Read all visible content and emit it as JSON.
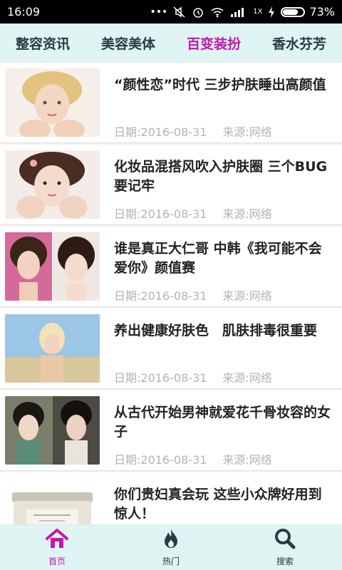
{
  "status": {
    "time": "16:09",
    "network_label": "1X",
    "battery_text": "73%",
    "battery_level": 0.73
  },
  "tabs": [
    {
      "label": "整容资讯",
      "active": false
    },
    {
      "label": "美容美体",
      "active": false
    },
    {
      "label": "百变装扮",
      "active": true
    },
    {
      "label": "香水芬芳",
      "active": false
    }
  ],
  "articles": [
    {
      "title": "“颜性恋”时代 三步护肤睡出高颜值",
      "date": "日期:2016-08-31",
      "source": "来源:网络",
      "thumb_icon": "portrait-thumb-1"
    },
    {
      "title": "化妆品混搭风吹入护肤圈 三个BUG要记牢",
      "date": "日期:2016-08-31",
      "source": "来源:网络",
      "thumb_icon": "portrait-thumb-2"
    },
    {
      "title": "谁是真正大仁哥 中韩《我可能不会爱你》颜值赛",
      "date": "日期:2016-08-31",
      "source": "来源:网络",
      "thumb_icon": "portrait-thumb-3"
    },
    {
      "title": "养出健康好肤色　肌肤排毒很重要",
      "date": "日期:2016-08-31",
      "source": "来源:网络",
      "thumb_icon": "portrait-thumb-4"
    },
    {
      "title": "从古代开始男神就爱花千骨妆容的女子",
      "date": "日期:2016-08-31",
      "source": "来源:网络",
      "thumb_icon": "portrait-thumb-5"
    },
    {
      "title": "你们贵妇真会玩 这些小众牌好用到惊人！",
      "date": "",
      "source": "",
      "thumb_icon": "product-jar-thumb"
    }
  ],
  "bottom_nav": [
    {
      "label": "首页",
      "icon": "home-icon",
      "active": true
    },
    {
      "label": "热门",
      "icon": "flame-icon",
      "active": false
    },
    {
      "label": "搜索",
      "icon": "search-icon",
      "active": false
    }
  ],
  "colors": {
    "accent": "#c317b0",
    "tab_bg": "#dff4f3",
    "meta_text": "#b3b3b3"
  }
}
